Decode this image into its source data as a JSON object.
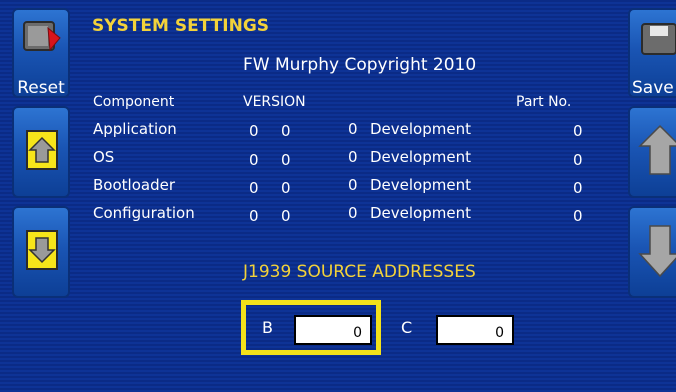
{
  "title": "SYSTEM SETTINGS",
  "copyright": "FW Murphy Copyright 2010",
  "buttons": {
    "reset_label": "Reset",
    "save_label": "Save"
  },
  "table": {
    "headers": {
      "component": "Component",
      "version": "VERSION",
      "part_no": "Part No."
    },
    "rows": [
      {
        "component": "Application",
        "v1": "0",
        "v2": "0",
        "v3": "0",
        "build": "Development",
        "part_no": "0"
      },
      {
        "component": "OS",
        "v1": "0",
        "v2": "0",
        "v3": "0",
        "build": "Development",
        "part_no": "0"
      },
      {
        "component": "Bootloader",
        "v1": "0",
        "v2": "0",
        "v3": "0",
        "build": "Development",
        "part_no": "0"
      },
      {
        "component": "Configuration",
        "v1": "0",
        "v2": "0",
        "v3": "0",
        "build": "Development",
        "part_no": "0"
      }
    ]
  },
  "source_addresses": {
    "title": "J1939 SOURCE ADDRESSES",
    "b_label": "B",
    "b_value": "0",
    "c_label": "C",
    "c_value": "0"
  },
  "colors": {
    "background": "#0b2b86",
    "accent_yellow": "#f3d23a",
    "focus_frame": "#f4e21a"
  },
  "icons": {
    "reset": "reset-icon",
    "up_left": "arrow-up-icon",
    "down_left": "arrow-down-icon",
    "save": "save-icon",
    "up_right": "arrow-up-icon",
    "down_right": "arrow-down-icon"
  }
}
